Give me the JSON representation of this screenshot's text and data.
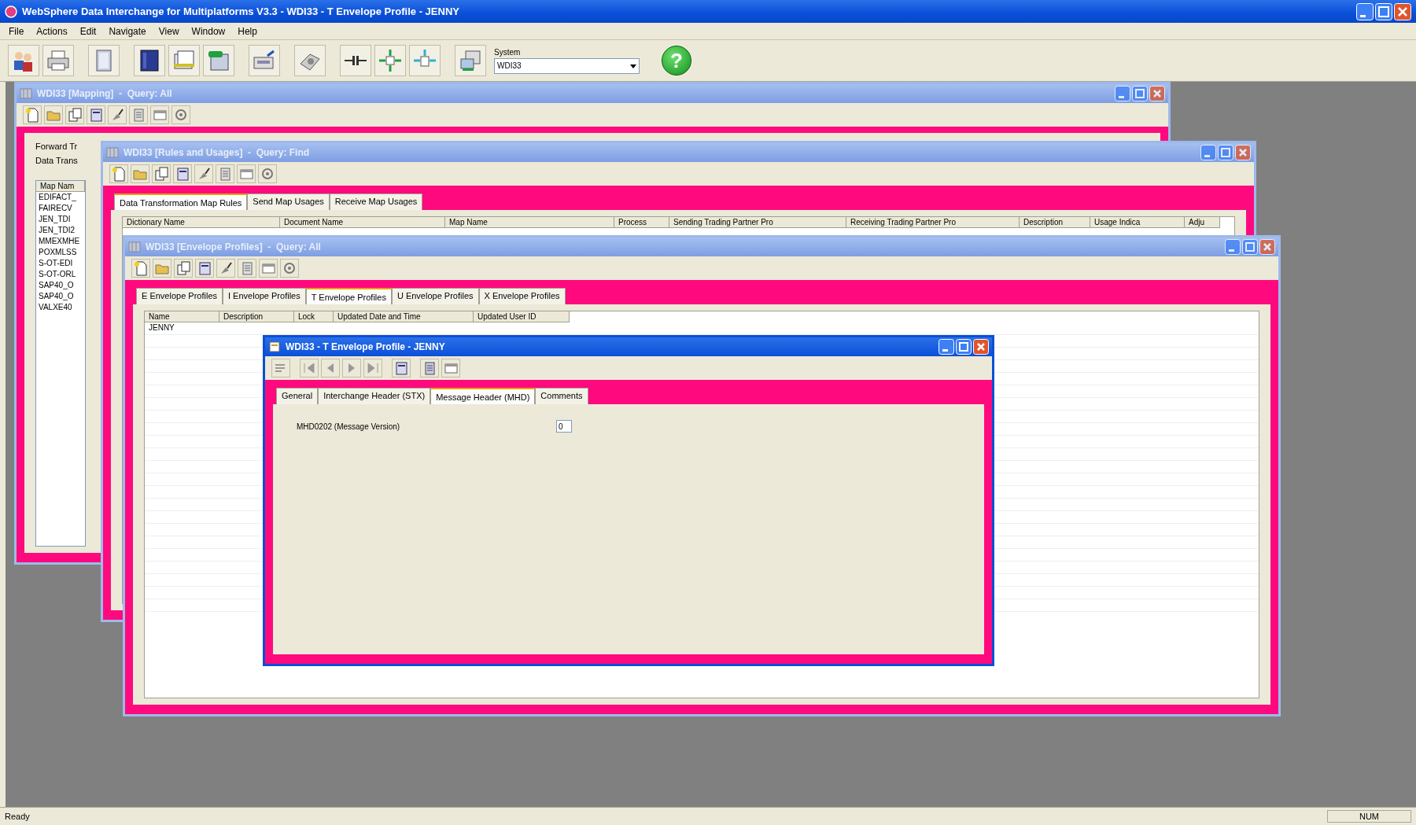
{
  "app": {
    "title": "WebSphere Data Interchange for Multiplatforms V3.3 - WDI33 - T Envelope Profile - JENNY",
    "menu": [
      "File",
      "Actions",
      "Edit",
      "Navigate",
      "View",
      "Window",
      "Help"
    ],
    "system": {
      "label": "System",
      "value": "WDI33"
    },
    "help": "?"
  },
  "windows": [
    {
      "kind": "mapping",
      "title": "WDI33 [Mapping]  -  Query: All",
      "active": false,
      "labels": [
        "Forward Tr",
        "Data Trans"
      ],
      "list": {
        "header": "Map Nam",
        "items": [
          "EDIFACT_",
          "FAIRECV",
          "JEN_TDI",
          "JEN_TDI2",
          "MMEXMHE",
          "POXMLSS",
          "S-OT-EDI",
          "S-OT-ORL",
          "SAP40_O",
          "SAP40_O",
          "VALXE40"
        ]
      }
    },
    {
      "kind": "rules",
      "title": "WDI33 [Rules and Usages]  -  Query: Find",
      "active": false,
      "tabs": [
        {
          "label": "Data Transformation Map Rules",
          "selected": true
        },
        {
          "label": "Send Map Usages",
          "selected": false
        },
        {
          "label": "Receive Map Usages",
          "selected": false
        }
      ],
      "columns": [
        "Dictionary Name",
        "Document Name",
        "Map Name",
        "Process",
        "Sending Trading Partner Pro",
        "Receiving Trading Partner Pro",
        "Description",
        "Usage Indica",
        "Adju"
      ]
    },
    {
      "kind": "profiles",
      "title": "WDI33 [Envelope Profiles]  -  Query: All",
      "active": false,
      "tabs": [
        {
          "label": "E Envelope Profiles",
          "selected": false
        },
        {
          "label": "I Envelope Profiles",
          "selected": false
        },
        {
          "label": "T Envelope Profiles",
          "selected": true
        },
        {
          "label": "U Envelope Profiles",
          "selected": false
        },
        {
          "label": "X Envelope Profiles",
          "selected": false
        }
      ],
      "columns": [
        "Name",
        "Description",
        "Lock",
        "Updated Date and Time",
        "Updated User ID"
      ],
      "rows": [
        [
          "JENNY"
        ]
      ]
    },
    {
      "kind": "detail",
      "title": "WDI33 - T Envelope Profile - JENNY",
      "active": true,
      "tabs": [
        {
          "label": "General",
          "selected": false
        },
        {
          "label": "Interchange Header (STX)",
          "selected": false
        },
        {
          "label": "Message Header (MHD)",
          "selected": true
        },
        {
          "label": "Comments",
          "selected": false
        }
      ],
      "fields": [
        {
          "label": "MHD0202 (Message Version)",
          "value": "0"
        }
      ]
    }
  ],
  "status_bar": {
    "message": "Ready",
    "indicators": [
      "NUM"
    ]
  }
}
